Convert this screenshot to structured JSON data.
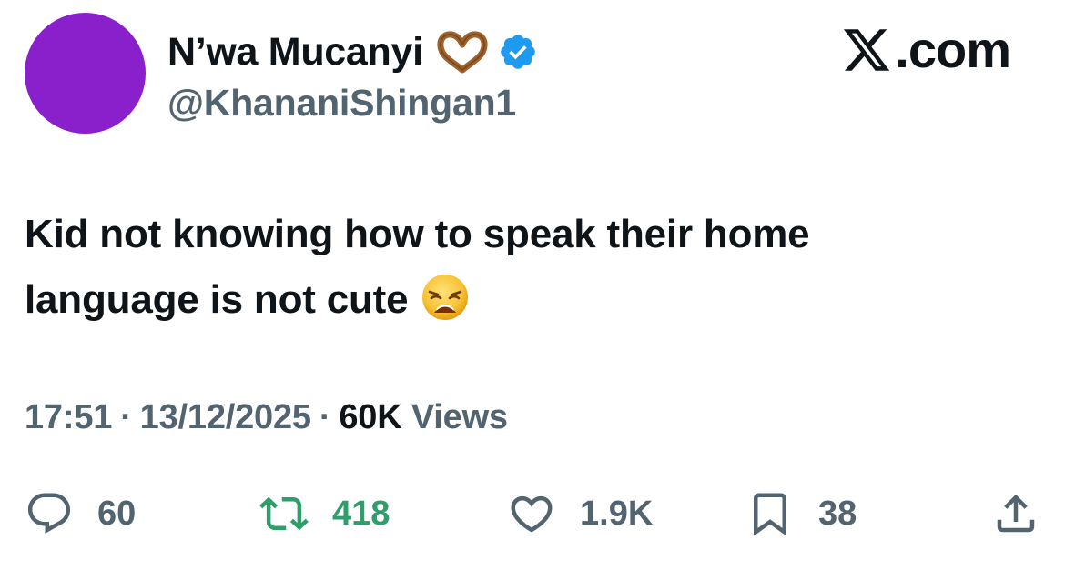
{
  "author": {
    "display_name": "N’wa Mucanyi",
    "handle": "@KhananiShingan1",
    "avatar_color": "#8a1fcc",
    "name_emoji": "heart-hands-icon",
    "verified": true,
    "verified_color": "#1d9bf0"
  },
  "site": {
    "logo": "x-logo-icon",
    "suffix": ".com"
  },
  "tweet": {
    "line1": "Kid not knowing how to speak their home",
    "line2": "language is not cute",
    "emoji": "weary-face-icon"
  },
  "meta": {
    "time": "17:51",
    "date": "13/12/2025",
    "separator": "·",
    "views_count": "60K",
    "views_label": "Views"
  },
  "actions": {
    "replies": "60",
    "retweets": "418",
    "likes": "1.9K",
    "bookmarks": "38"
  },
  "colors": {
    "text_primary": "#0f1419",
    "text_secondary": "#536471",
    "retweet_green": "#2e9e6a"
  }
}
